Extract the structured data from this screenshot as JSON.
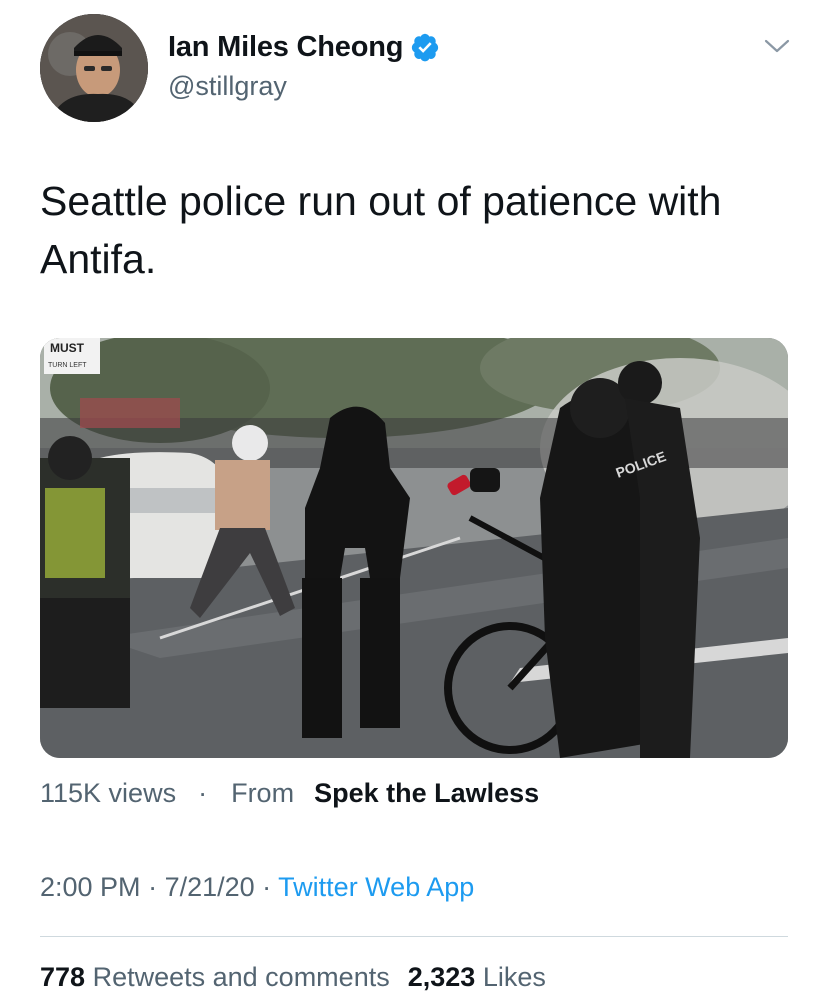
{
  "author": {
    "display_name": "Ian Miles Cheong",
    "handle": "@stillgray",
    "verified": true,
    "verified_icon": "verified-badge-icon",
    "verified_color": "#1d9bf0"
  },
  "tweet": {
    "text": "Seattle police run out of patience with Antifa."
  },
  "media": {
    "sign_line1": "MUST",
    "sign_line2": "TURN LEFT",
    "police_text": "POLICE"
  },
  "video_meta": {
    "views": "115K views",
    "separator": "·",
    "from_label": "From",
    "source": "Spek the Lawless"
  },
  "timestamp": {
    "time": "2:00 PM",
    "sep1": " · ",
    "date": "7/21/20",
    "sep2": " · ",
    "app": "Twitter Web App"
  },
  "stats": {
    "retweets_count": "778",
    "retweets_label": "Retweets and comments",
    "likes_count": "2,323",
    "likes_label": "Likes"
  },
  "colors": {
    "text_primary": "#0f1419",
    "text_secondary": "#536471",
    "link": "#1d9bf0",
    "divider": "#cfd9de"
  }
}
